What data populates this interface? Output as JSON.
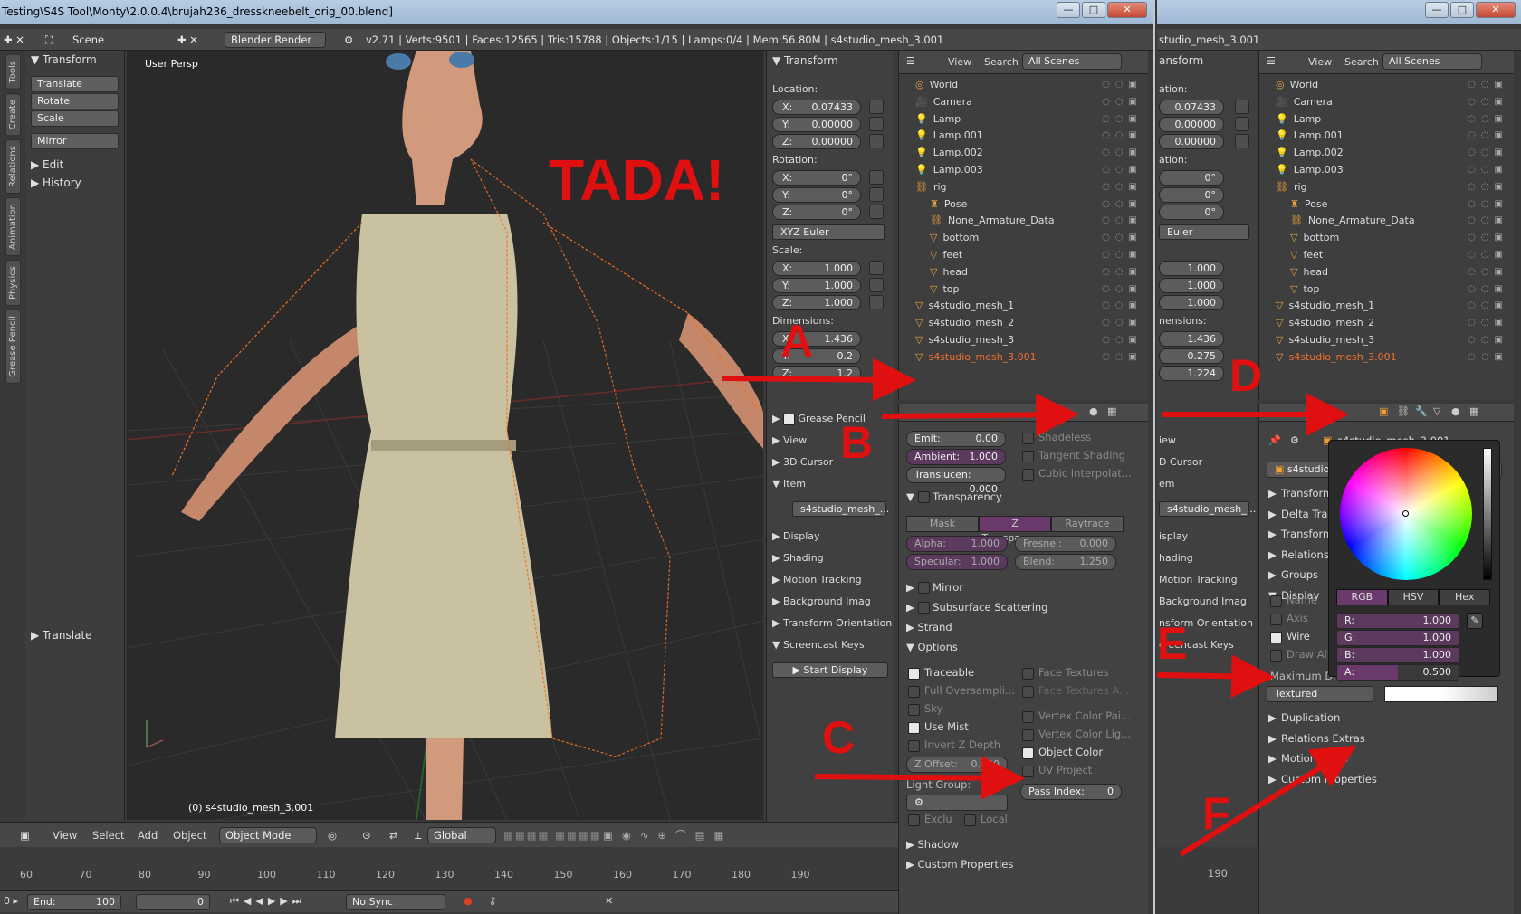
{
  "window1": {
    "title": "Testing\\S4S Tool\\Monty\\2.0.0.4\\brujah236_dresskneebelt_orig_00.blend]",
    "info": {
      "scene_label": "Scene",
      "render_engine": "Blender Render",
      "stats": "v2.71 | Verts:9501 | Faces:12565 | Tris:15788 | Objects:1/15 | Lamps:0/4 | Mem:56.80M | s4studio_mesh_3.001"
    },
    "tool_tabs": [
      "Tools",
      "Create",
      "Relations",
      "Animation",
      "Physics",
      "Grease Pencil"
    ],
    "toolshelf": {
      "transform_header": "Transform",
      "buttons": [
        "Translate",
        "Rotate",
        "Scale"
      ],
      "mirror": "Mirror",
      "edit": "Edit",
      "history": "History",
      "operator": "Translate"
    },
    "viewport": {
      "persp_label": "User Persp",
      "overlay_text": "TADA!",
      "object_label": "(0) s4studio_mesh_3.001"
    },
    "npanel": {
      "transform": "Transform",
      "location": "Location:",
      "loc": [
        {
          "k": "X:",
          "v": "0.07433"
        },
        {
          "k": "Y:",
          "v": "0.00000"
        },
        {
          "k": "Z:",
          "v": "0.00000"
        }
      ],
      "rotation": "Rotation:",
      "rot": [
        {
          "k": "X:",
          "v": "0°"
        },
        {
          "k": "Y:",
          "v": "0°"
        },
        {
          "k": "Z:",
          "v": "0°"
        }
      ],
      "euler": "XYZ Euler",
      "scale": "Scale:",
      "scl": [
        {
          "k": "X:",
          "v": "1.000"
        },
        {
          "k": "Y:",
          "v": "1.000"
        },
        {
          "k": "Z:",
          "v": "1.000"
        }
      ],
      "dimensions": "Dimensions:",
      "dim": [
        {
          "k": "X:",
          "v": "1.436"
        },
        {
          "k": "Y:",
          "v": "0.2"
        },
        {
          "k": "Z:",
          "v": "1.2"
        }
      ],
      "sections": [
        "Grease Pencil",
        "View",
        "3D Cursor",
        "Item"
      ],
      "item_name": "s4studio_mesh_...",
      "sections2": [
        "Display",
        "Shading",
        "Motion Tracking",
        "Background Imag",
        "Transform Orientation",
        "Screencast Keys"
      ],
      "start_display": "Start Display"
    },
    "outliner": {
      "menu": [
        "View",
        "Search"
      ],
      "scenes": "All Scenes",
      "rows": [
        "World",
        "Camera",
        "Lamp",
        "Lamp.001",
        "Lamp.002",
        "Lamp.003",
        "rig",
        "Pose",
        "None_Armature_Data",
        "bottom",
        "feet",
        "head",
        "top",
        "s4studio_mesh_1",
        "s4studio_mesh_2",
        "s4studio_mesh_3",
        "s4studio_mesh_3.001"
      ]
    },
    "material": {
      "emit": {
        "k": "Emit:",
        "v": "0.00"
      },
      "ambient": {
        "k": "Ambient:",
        "v": "1.000"
      },
      "translucency": {
        "k": "Translucen:",
        "v": "0.000"
      },
      "shadeless": "Shadeless",
      "tangent": "Tangent Shading",
      "cubic": "Cubic Interpolat...",
      "transparency": "Transparency",
      "trans_tabs": [
        "Mask",
        "Z Transparency",
        "Raytrace"
      ],
      "alpha": {
        "k": "Alpha:",
        "v": "1.000"
      },
      "fresnel": {
        "k": "Fresnel:",
        "v": "0.000"
      },
      "specular": {
        "k": "Specular:",
        "v": "1.000"
      },
      "blend": {
        "k": "Blend:",
        "v": "1.250"
      },
      "mirror": "Mirror",
      "sss": "Subsurface Scattering",
      "strand": "Strand",
      "options": "Options",
      "traceable": "Traceable",
      "full_over": "Full Oversampli...",
      "sky": "Sky",
      "use_mist": "Use Mist",
      "invert": "Invert Z Depth",
      "face_tex": "Face Textures",
      "face_tex_a": "Face Textures A...",
      "vcol_paint": "Vertex Color Pai...",
      "vcol_light": "Vertex Color Lig...",
      "object_color": "Object Color",
      "uv_project": "UV Project",
      "z_offset": {
        "k": "Z Offset:",
        "v": "0.000"
      },
      "light_group": "Light Group:",
      "pass_index": {
        "k": "Pass Index:",
        "v": "0"
      },
      "exclu": "Exclu",
      "local": "Local",
      "shadow": "Shadow",
      "custom": "Custom Properties"
    },
    "header3d": {
      "menus": [
        "View",
        "Select",
        "Add",
        "Object"
      ],
      "mode": "Object Mode",
      "orientation": "Global"
    },
    "timeline": {
      "ticks": [
        "60",
        "70",
        "80",
        "90",
        "100",
        "110",
        "120",
        "130",
        "140",
        "150",
        "160",
        "170",
        "180",
        "190"
      ],
      "end": "End:",
      "end_val": "100",
      "frame": "0",
      "sync": "No Sync"
    },
    "annotations": [
      "A",
      "B",
      "C",
      "D",
      "E",
      "F"
    ]
  },
  "window2": {
    "title": "studio_mesh_3.001",
    "outliner_rows": [
      "World",
      "Camera",
      "Lamp",
      "Lamp.001",
      "Lamp.002",
      "Lamp.003",
      "rig",
      "Pose",
      "None_Armature_Data",
      "bottom",
      "feet",
      "head",
      "top",
      "s4studio_mesh_1",
      "s4studio_mesh_2",
      "s4studio_mesh_3",
      "s4studio_mesh_3.001"
    ],
    "object_name": "s4studio_mesh_3.001",
    "object_field": "s4studio_mesh_3.001",
    "sections": [
      "Transform",
      "Delta Trans",
      "Transform",
      "Relations",
      "Groups",
      "Display"
    ],
    "display": {
      "name": "Name",
      "axis": "Axis",
      "wire": "Wire",
      "draw_all": "Draw All E",
      "max_draw": "Maximum Dra",
      "textured": "Textured"
    },
    "sections_after": [
      "Duplication",
      "Relations Extras",
      "Motion Paths",
      "Custom Properties"
    ],
    "color_picker": {
      "tabs": [
        "RGB",
        "HSV",
        "Hex"
      ],
      "r": {
        "k": "R:",
        "v": "1.000"
      },
      "g": {
        "k": "G:",
        "v": "1.000"
      },
      "b": {
        "k": "B:",
        "v": "1.000"
      },
      "a": {
        "k": "A:",
        "v": "0.500"
      }
    },
    "timeline_tick": "190"
  }
}
